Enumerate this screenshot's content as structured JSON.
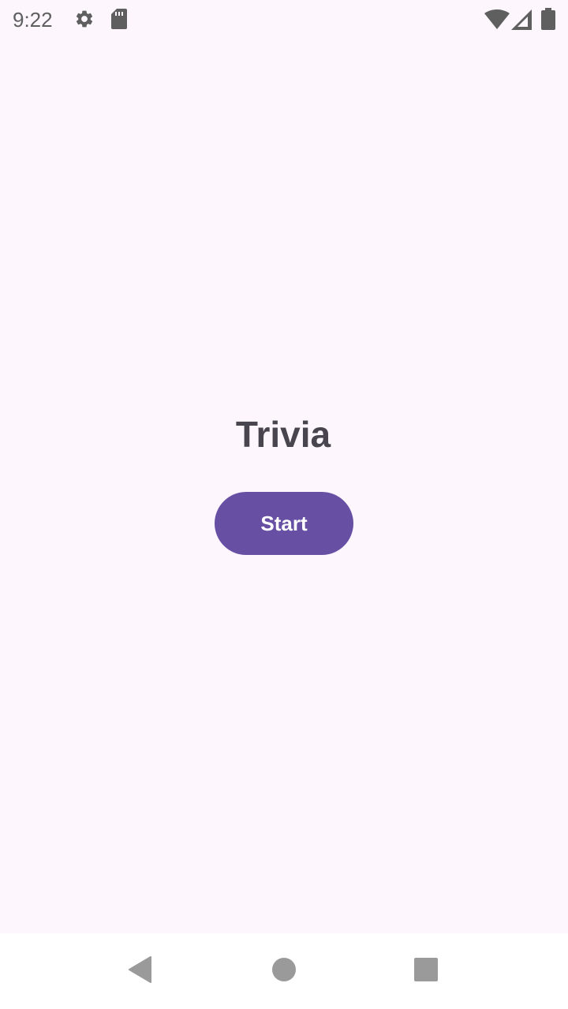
{
  "status_bar": {
    "time": "9:22",
    "left_icons": [
      "gear-icon",
      "sd-card-icon"
    ],
    "right_icons": [
      "wifi-icon",
      "signal-icon",
      "battery-icon"
    ]
  },
  "main": {
    "title": "Trivia",
    "start_label": "Start"
  },
  "nav_bar": {
    "buttons": [
      "back-icon",
      "home-icon",
      "recents-icon"
    ]
  },
  "colors": {
    "background": "#fdf7fd",
    "accent": "#6750a4",
    "title_text": "#49454f"
  }
}
